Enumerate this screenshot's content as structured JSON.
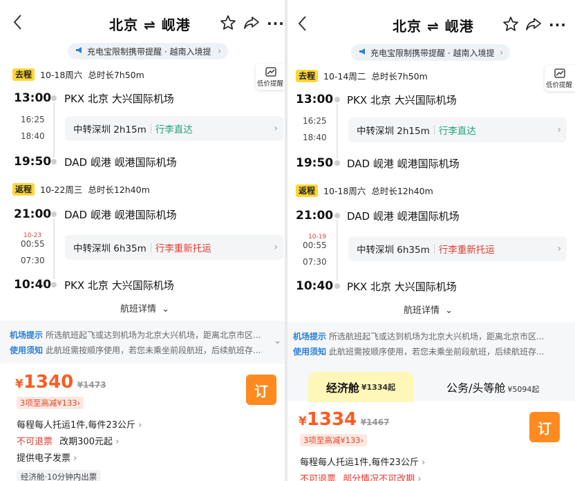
{
  "left": {
    "title": "北京 ⇌ 岘港",
    "notice": "充电宝限制携带提醒 · 越南入境提",
    "low_price_label": "低价提醒",
    "outbound": {
      "tag": "去程",
      "date": "10-18周六",
      "duration": "总时长7h50m",
      "dep_time": "13:00",
      "dep_airport": "PKX  北京  大兴国际机场",
      "stop_arr": "16:25",
      "stop_dep": "18:40",
      "transfer": "中转深圳 2h15m",
      "baggage": "行李直达",
      "arr_time": "19:50",
      "arr_airport": "DAD  岘港  岘港国际机场"
    },
    "inbound": {
      "tag": "返程",
      "date": "10-22周三",
      "duration": "总时长12h40m",
      "dep_time": "21:00",
      "dep_airport": "DAD  岘港  岘港国际机场",
      "next_day": "10-23",
      "stop_arr": "00:55",
      "stop_dep": "07:30",
      "transfer": "中转深圳 6h35m",
      "baggage": "行李重新托运",
      "arr_time": "10:40",
      "arr_airport": "PKX  北京  大兴国际机场"
    },
    "flight_detail": "航班详情",
    "tip1_label": "机场提示",
    "tip1": "所选航班起飞或达到机场为北京大兴机场，距离北京市区...",
    "tip2_label": "使用须知",
    "tip2": "此航班需按顺序使用，若您未乘坐前段航班，后续航班存...",
    "price_yen": "¥",
    "price": "1340",
    "orig_price": "¥1473",
    "promo": "3项至高减¥133",
    "book": "订",
    "baggage_rule": "每程每人托运1件,每件23公斤",
    "refund_rule": "不可退票",
    "change_rule": "改期300元起",
    "invoice": "提供电子发票",
    "foot_tag": "经济舱·10分钟内出票"
  },
  "right": {
    "title": "北京 ⇌ 岘港",
    "notice": "充电宝限制携带提醒 · 越南入境提",
    "low_price_label": "低价提醒",
    "outbound": {
      "tag": "去程",
      "date": "10-14周二",
      "duration": "总时长7h50m",
      "dep_time": "13:00",
      "dep_airport": "PKX  北京  大兴国际机场",
      "stop_arr": "16:25",
      "stop_dep": "18:40",
      "transfer": "中转深圳 2h15m",
      "baggage": "行李直达",
      "arr_time": "19:50",
      "arr_airport": "DAD  岘港  岘港国际机场"
    },
    "inbound": {
      "tag": "返程",
      "date": "10-18周六",
      "duration": "总时长12h40m",
      "dep_time": "21:00",
      "dep_airport": "DAD  岘港  岘港国际机场",
      "next_day": "10-19",
      "stop_arr": "00:55",
      "stop_dep": "07:30",
      "transfer": "中转深圳 6h35m",
      "baggage": "行李重新托运",
      "arr_time": "10:40",
      "arr_airport": "PKX  北京  大兴国际机场"
    },
    "flight_detail": "航班详情",
    "tip1_label": "机场提示",
    "tip1": "所选航班起飞或达到机场为北京大兴机场，距离北京市区...",
    "tip2_label": "使用须知",
    "tip2": "此航班需按顺序使用，若您未乘坐前段航班，后续航班存...",
    "cabin_economy": "经济舱",
    "cabin_economy_price": "¥1334起",
    "cabin_business": "公务/头等舱",
    "cabin_business_price": "¥5094起",
    "price_yen": "¥",
    "price": "1334",
    "orig_price": "¥1467",
    "promo": "3项至高减¥133",
    "book": "订",
    "baggage_rule": "每程每人托运1件,每件23公斤",
    "refund_rule": "不可退票",
    "change_rule": "部分情况不可改期"
  },
  "colors": {
    "accent_orange": "#ff8a1f",
    "price_red": "#ff5a1f",
    "tag_yellow": "#ffd633",
    "green": "#1aa37a",
    "red": "#e23a2f"
  }
}
